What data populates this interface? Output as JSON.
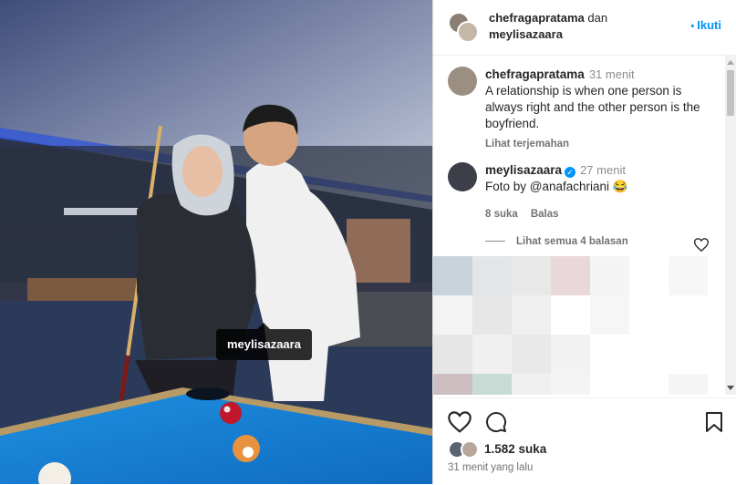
{
  "photo": {
    "tag": "meylisazaara"
  },
  "header": {
    "user1": "chefragapratama",
    "joiner": "dan",
    "user2": "meylisazaara",
    "follow": "Ikuti"
  },
  "comments": [
    {
      "user": "chefragapratama",
      "time": "31 menit",
      "text": "A relationship is when one person is always right and the other person is the boyfriend.",
      "translate": "Lihat terjemahan"
    },
    {
      "user": "meylisazaara",
      "time": "27 menit",
      "text": "Foto by @anafachriani 😂",
      "likes": "8 suka",
      "reply": "Balas",
      "view_replies": "Lihat semua 4 balasan"
    }
  ],
  "footer": {
    "likes": "1.582 suka",
    "time_ago": "31 menit yang lalu"
  },
  "colors": {
    "accent": "#0095f6",
    "muted": "#737373"
  },
  "icons": [
    "heart-icon",
    "comment-icon",
    "bookmark-icon",
    "verified-icon"
  ]
}
